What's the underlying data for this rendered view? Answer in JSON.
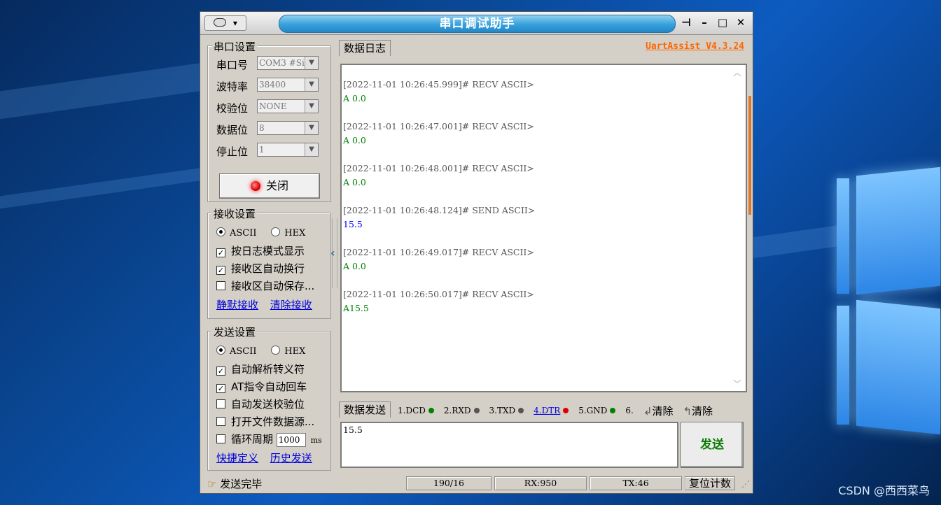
{
  "titlebar": {
    "menu_icon": "emblem-icon",
    "menu_caret": "▾",
    "title": "串口调试助手",
    "pin": "⊣",
    "minimize": "–",
    "maximize": "□",
    "close": "✕"
  },
  "serial": {
    "title": "串口设置",
    "port_label": "串口号",
    "port_value": "COM3 #Si]",
    "baud_label": "波特率",
    "baud_value": "38400",
    "parity_label": "校验位",
    "parity_value": "NONE",
    "databits_label": "数据位",
    "databits_value": "8",
    "stopbits_label": "停止位",
    "stopbits_value": "1",
    "close_button": "关闭"
  },
  "receive": {
    "title": "接收设置",
    "ascii": "ASCII",
    "hex": "HEX",
    "opt_log": "按日志模式显示",
    "opt_wrap": "接收区自动换行",
    "opt_save": "接收区自动保存...",
    "link_mute": "静默接收",
    "link_clear": "清除接收"
  },
  "send_settings": {
    "title": "发送设置",
    "ascii": "ASCII",
    "hex": "HEX",
    "opt_escape": "自动解析转义符",
    "opt_at": "AT指令自动回车",
    "opt_checksum": "自动发送校验位",
    "opt_file": "打开文件数据源...",
    "opt_cycle": "循环周期",
    "cycle_value": "1000",
    "cycle_unit": "ms",
    "link_shortcut": "快捷定义",
    "link_history": "历史发送"
  },
  "log": {
    "tab": "数据日志",
    "brand": "UartAssist V4.3.24",
    "entries": [
      {
        "head": "[2022-11-01 10:26:45.999]# RECV ASCII>",
        "body": "A 0.0",
        "kind": "recv"
      },
      {
        "head": "[2022-11-01 10:26:47.001]# RECV ASCII>",
        "body": "A 0.0",
        "kind": "recv"
      },
      {
        "head": "[2022-11-01 10:26:48.001]# RECV ASCII>",
        "body": "A 0.0",
        "kind": "recv"
      },
      {
        "head": "[2022-11-01 10:26:48.124]# SEND ASCII>",
        "body": "15.5",
        "kind": "send"
      },
      {
        "head": "[2022-11-01 10:26:49.017]# RECV ASCII>",
        "body": "A 0.0",
        "kind": "recv"
      },
      {
        "head": "[2022-11-01 10:26:50.017]# RECV ASCII>",
        "body": "A15.5",
        "kind": "recv"
      }
    ]
  },
  "sendarea": {
    "tab": "数据发送",
    "signals": [
      {
        "label": "1.DCD",
        "color": "#008000",
        "link": false
      },
      {
        "label": "2.RXD",
        "color": "#555555",
        "link": false
      },
      {
        "label": "3.TXD",
        "color": "#555555",
        "link": false
      },
      {
        "label": "4.DTR",
        "color": "#dd0000",
        "link": true
      },
      {
        "label": "5.GND",
        "color": "#008000",
        "link": false
      },
      {
        "label": "6.",
        "color": "",
        "link": false
      }
    ],
    "clear1": "清除",
    "clear2": "清除",
    "input_value": "15.5",
    "send_button": "发送"
  },
  "statusbar": {
    "message": "发送完毕",
    "counter": "190/16",
    "rx": "RX:950",
    "tx": "TX:46",
    "reset": "复位计数"
  },
  "watermark": "CSDN @西西菜鸟"
}
